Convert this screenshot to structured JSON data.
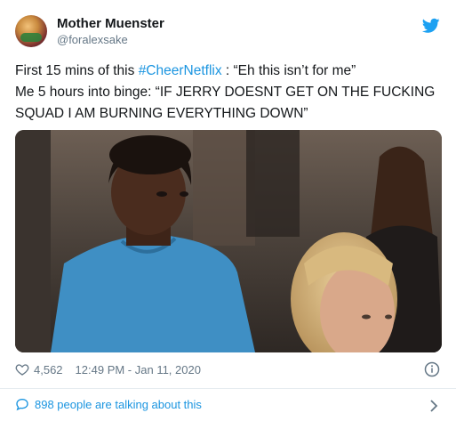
{
  "user": {
    "display_name": "Mother Muenster",
    "handle": "@foralexsake"
  },
  "tweet": {
    "line1_prefix": "First 15 mins of this ",
    "hashtag": "#CheerNetflix",
    "line1_suffix": " : “Eh this isn’t for me”",
    "line2": "Me 5 hours into binge: “IF JERRY DOESNT GET ON THE FUCKING SQUAD I AM BURNING EVERYTHING DOWN”"
  },
  "meta": {
    "like_count": "4,562",
    "timestamp": "12:49 PM - Jan 11, 2020"
  },
  "conversation": {
    "label": "898 people are talking about this"
  },
  "colors": {
    "link": "#1b95e0",
    "secondary_text": "#657786",
    "primary_text": "#14171a"
  },
  "icons": [
    "avatar",
    "twitter-bird-icon",
    "heart-icon",
    "info-icon",
    "speech-bubble-icon",
    "chevron-right-icon"
  ]
}
